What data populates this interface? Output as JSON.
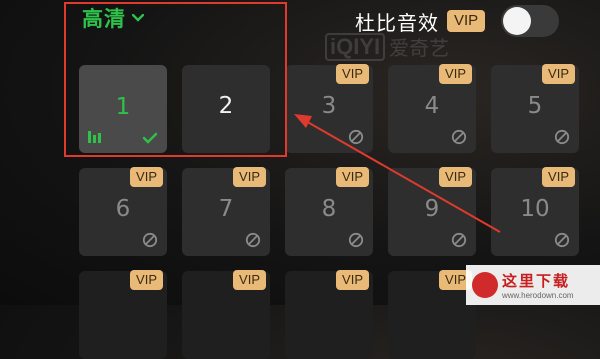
{
  "header": {
    "quality_label": "高清",
    "dolby_label": "杜比音效",
    "dolby_vip_badge": "VIP",
    "dolby_enabled": false
  },
  "watermark": {
    "logo": "iQIYI",
    "text": "爱奇艺"
  },
  "episodes": [
    {
      "number": "1",
      "selected": true,
      "vip": false,
      "locked": false
    },
    {
      "number": "2",
      "selected": false,
      "vip": false,
      "locked": false
    },
    {
      "number": "3",
      "selected": false,
      "vip": true,
      "vip_label": "VIP",
      "locked": true
    },
    {
      "number": "4",
      "selected": false,
      "vip": true,
      "vip_label": "VIP",
      "locked": true
    },
    {
      "number": "5",
      "selected": false,
      "vip": true,
      "vip_label": "VIP",
      "locked": true
    },
    {
      "number": "6",
      "selected": false,
      "vip": true,
      "vip_label": "VIP",
      "locked": true
    },
    {
      "number": "7",
      "selected": false,
      "vip": true,
      "vip_label": "VIP",
      "locked": true
    },
    {
      "number": "8",
      "selected": false,
      "vip": true,
      "vip_label": "VIP",
      "locked": true
    },
    {
      "number": "9",
      "selected": false,
      "vip": true,
      "vip_label": "VIP",
      "locked": true
    },
    {
      "number": "10",
      "selected": false,
      "vip": true,
      "vip_label": "VIP",
      "locked": true
    },
    {
      "number": "",
      "selected": false,
      "vip": true,
      "vip_label": "VIP",
      "locked": true
    },
    {
      "number": "",
      "selected": false,
      "vip": true,
      "vip_label": "VIP",
      "locked": true
    },
    {
      "number": "",
      "selected": false,
      "vip": true,
      "vip_label": "VIP",
      "locked": true
    },
    {
      "number": "",
      "selected": false,
      "vip": true,
      "vip_label": "VIP",
      "locked": true
    }
  ],
  "site_logo": {
    "name": "这里下载",
    "url": "www.herodown.com"
  },
  "colors": {
    "accent_green": "#2ec24a",
    "vip_gold": "#e9b978",
    "annotation_red": "#e03a2e"
  }
}
